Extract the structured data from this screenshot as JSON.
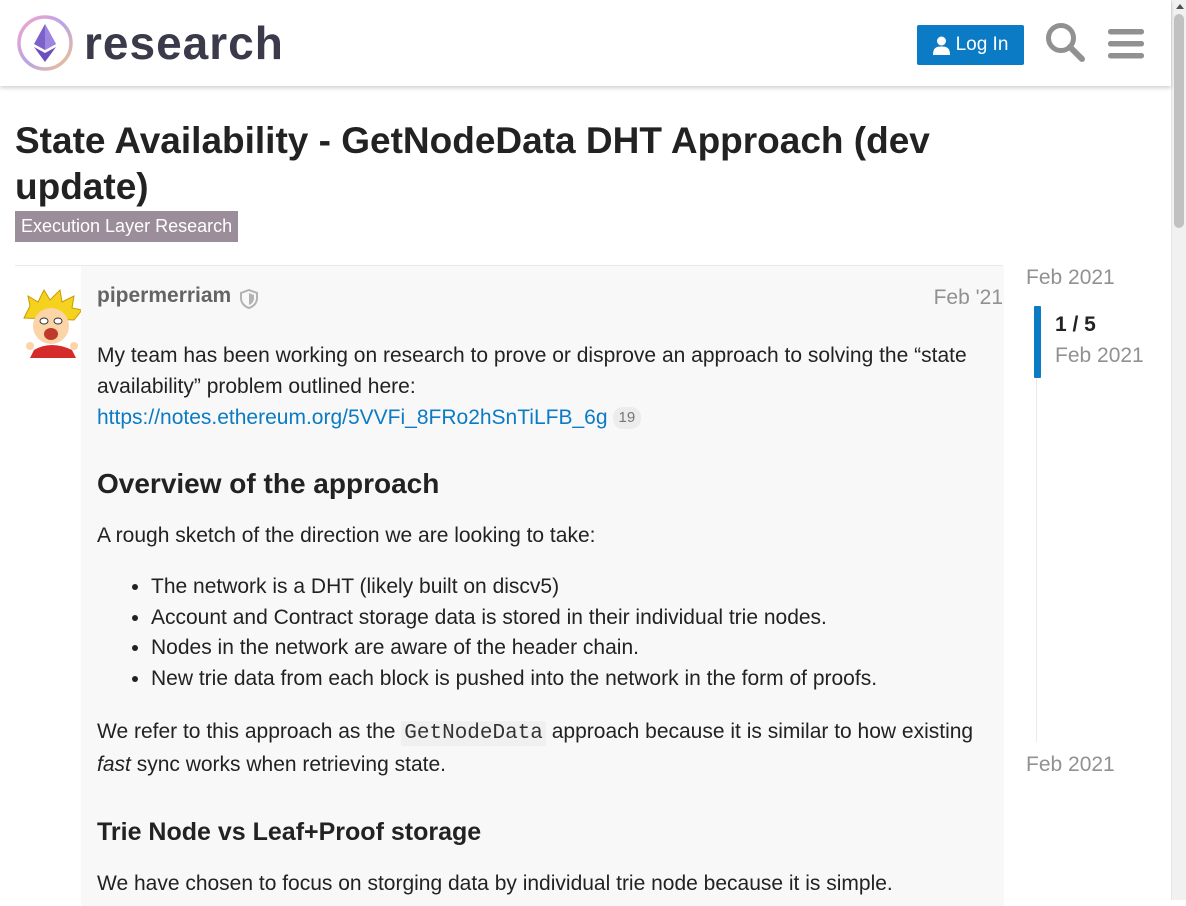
{
  "header": {
    "logo_text": "research",
    "login_label": "Log In",
    "icons": {
      "login": "user-icon",
      "search": "search-icon",
      "menu": "hamburger-menu-icon"
    }
  },
  "topic": {
    "title": "State Availability - GetNodeData DHT Approach (dev update)",
    "category": "Execution Layer Research",
    "category_color": "#9b8e9a"
  },
  "post": {
    "username": "pipermerriam",
    "date": "Feb '21",
    "p1": "My team has been working on research to prove or disprove an approach to solving the “state availability” problem outlined here:",
    "link_text": "https://notes.ethereum.org/5VVFi_8FRo2hSnTiLFB_6g",
    "link_clicks": "19",
    "h2_overview": "Overview of the approach",
    "p2": "A rough sketch of the direction we are looking to take:",
    "bullets": [
      "The network is a DHT (likely built on discv5)",
      "Account and Contract storage data is stored in their individual trie nodes.",
      "Nodes in the network are aware of the header chain.",
      "New trie data from each block is pushed into the network in the form of proofs."
    ],
    "p3_before": "We refer to this approach as the ",
    "p3_code": "GetNodeData",
    "p3_middle": " approach because it is similar to how existing ",
    "p3_em": "fast",
    "p3_after": " sync works when retrieving state.",
    "h2_storage": "Trie Node vs Leaf+Proof storage",
    "p4": "We have chosen to focus on storging data by individual trie node because it is simple."
  },
  "timeline": {
    "start_date": "Feb 2021",
    "position": "1 / 5",
    "handle_date": "Feb 2021",
    "end_date": "Feb 2021"
  },
  "colors": {
    "accent": "#0a7bc4",
    "muted_text": "#919191",
    "post_background": "#f8f8f8"
  }
}
